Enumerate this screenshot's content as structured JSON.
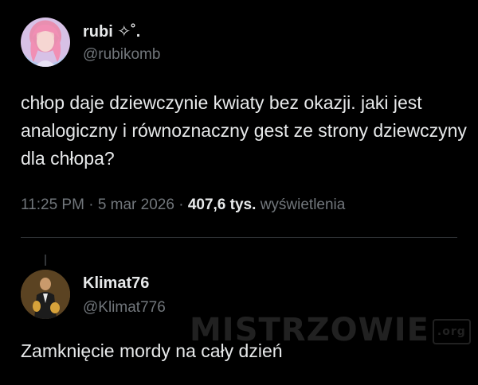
{
  "post": {
    "author_name": "rubi ✧˚.",
    "author_handle": "@rubikomb",
    "text": "chłop daje dziewczynie kwiaty bez okazji. jaki jest analogiczny i równoznaczny gest ze strony dziewczyny dla chłopa?",
    "time": "11:25 PM",
    "date": "5 mar 2026",
    "views_count": "407,6 tys.",
    "views_label": "wyświetlenia",
    "separator": "·"
  },
  "reply": {
    "author_name": "Klimat76",
    "author_handle": "@Klimat776",
    "text": "Zamknięcie mordy na cały dzień"
  },
  "watermark": {
    "text": "MISTRZOWIE",
    "box": ".org"
  }
}
